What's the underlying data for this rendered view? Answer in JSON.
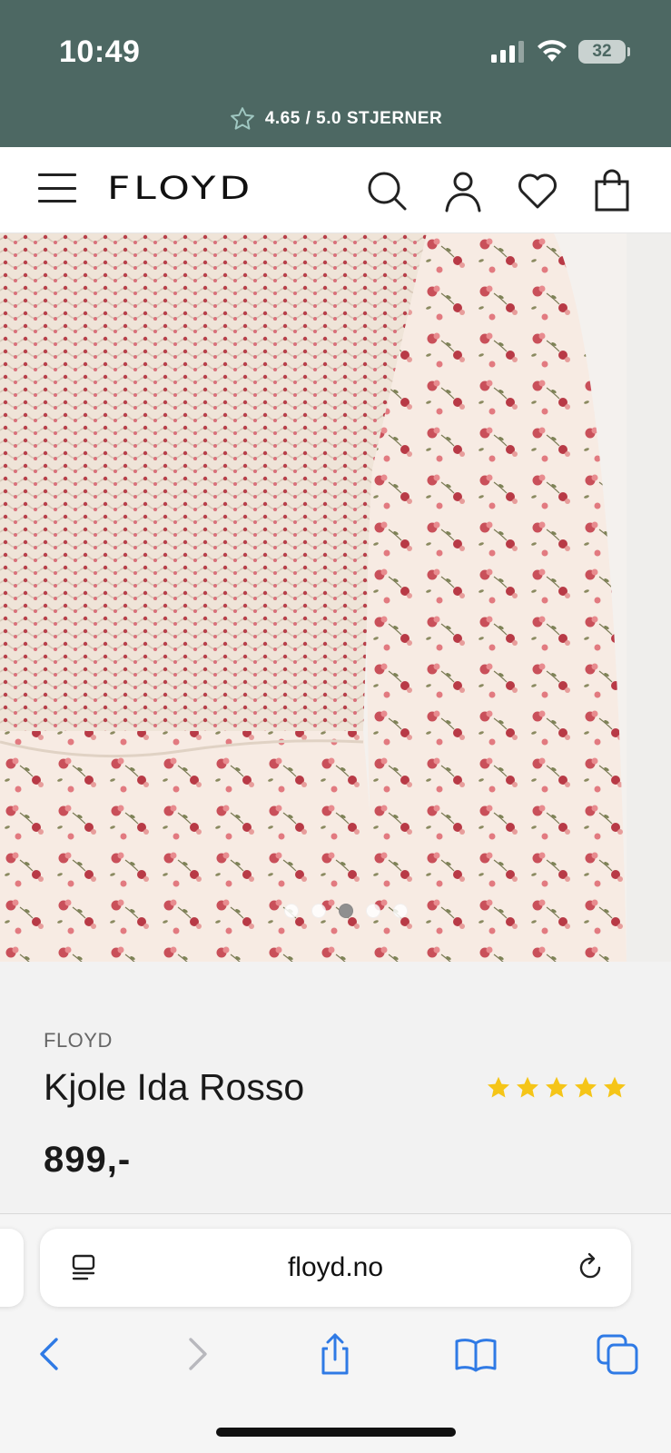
{
  "status_bar": {
    "time": "10:49",
    "battery": "32",
    "icons": [
      "cellular-signal-icon",
      "wifi-icon",
      "battery-icon"
    ]
  },
  "store_rating": {
    "text": "4.65 / 5.0 STJERNER",
    "icon": "star-outline-icon"
  },
  "header": {
    "logo": "FLOYD",
    "icons": [
      "menu-icon",
      "search-icon",
      "account-icon",
      "wishlist-heart-icon",
      "cart-bag-icon"
    ]
  },
  "gallery": {
    "image": "floral smocked dress with pink and red roses",
    "slide_count": 5,
    "active_slide": 3
  },
  "product": {
    "brand": "FLOYD",
    "name": "Kjole Ida Rosso",
    "rating_stars": 5,
    "price": "899,-"
  },
  "browser": {
    "url": "floyd.no",
    "toolbar": [
      "back-icon",
      "forward-icon",
      "share-icon",
      "bookmarks-icon",
      "tabs-icon"
    ]
  },
  "colors": {
    "header_green": "#4d6863",
    "star_yellow": "#f5c518",
    "link_blue": "#2f7ae5",
    "text_dark": "#1a1a1a"
  }
}
